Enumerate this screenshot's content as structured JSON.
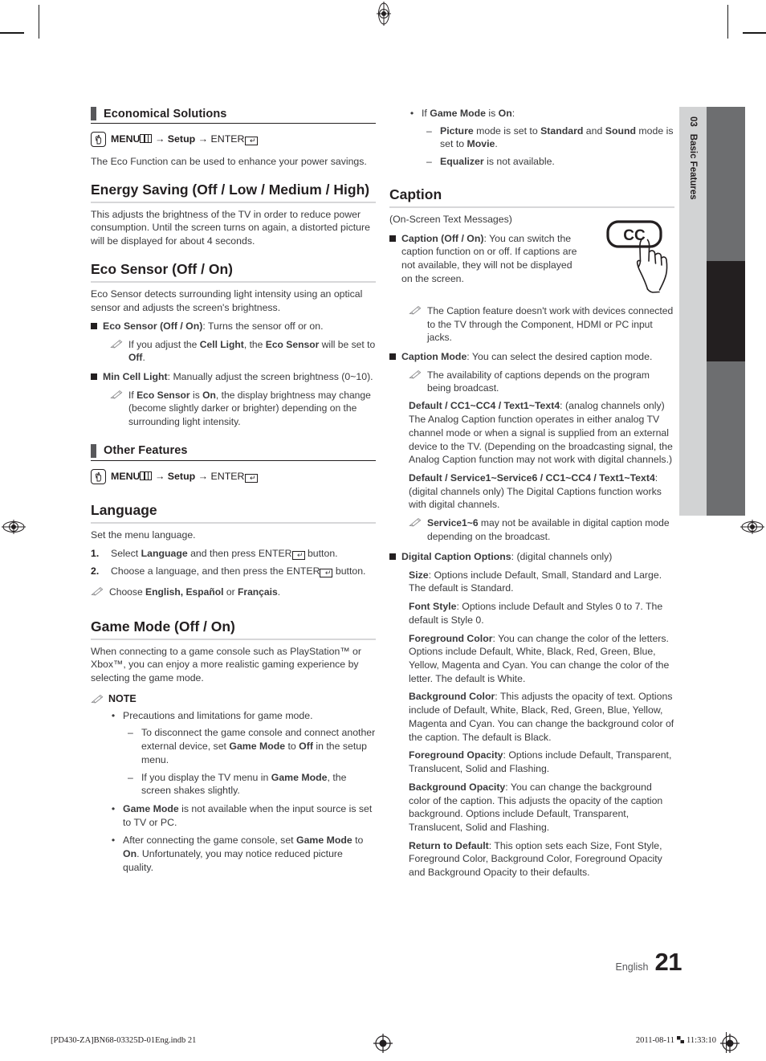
{
  "sidetab": {
    "chapter": "03",
    "title": "Basic Features"
  },
  "page": {
    "language": "English",
    "number": "21"
  },
  "footer": {
    "left": "[PD430-ZA]BN68-03325D-01Eng.indb   21",
    "date": "2011-08-11",
    "time": "11:33:10"
  },
  "left_column": {
    "band1": {
      "label": "Economical Solutions"
    },
    "menu_path1": {
      "menu": "MENU",
      "arrow1": "→",
      "setup": "Setup",
      "arrow2": "→",
      "enter": "ENTER"
    },
    "intro1": "The Eco Function can be used to enhance your power savings.",
    "energy_saving": {
      "heading": "Energy Saving (Off / Low / Medium / High)",
      "body": "This adjusts the brightness of the TV in order to reduce power consumption. Until the screen turns on again, a distorted picture will be displayed for about 4 seconds."
    },
    "eco_sensor": {
      "heading": "Eco Sensor (Off / On)",
      "body": "Eco Sensor detects surrounding light intensity using an optical sensor and adjusts the screen's brightness.",
      "item1_bold": "Eco Sensor (Off / On)",
      "item1_rest": ": Turns the sensor off or on.",
      "note1_a": "If you adjust the ",
      "note1_b": "Cell Light",
      "note1_c": ", the ",
      "note1_d": "Eco Sensor",
      "note1_e": " will be set to ",
      "note1_f": "Off",
      "note1_g": ".",
      "item2_bold": "Min Cell Light",
      "item2_rest": ": Manually adjust the screen brightness (0~10).",
      "note2_a": "If ",
      "note2_b": "Eco Sensor",
      "note2_c": " is ",
      "note2_d": "On",
      "note2_e": ", the display brightness may change (become slightly darker or brighter) depending on the surrounding light intensity."
    },
    "band2": {
      "label": "Other Features"
    },
    "menu_path2": {
      "menu": "MENU",
      "arrow1": "→",
      "setup": "Setup",
      "arrow2": "→",
      "enter": "ENTER"
    },
    "language": {
      "heading": "Language",
      "body": "Set the menu language.",
      "step1_n": "1.",
      "step1_a": "Select ",
      "step1_b": "Language",
      "step1_c": " and then press ENTER",
      "step1_d": " button.",
      "step2_n": "2.",
      "step2_a": "Choose a language, and then press the ENTER",
      "step2_b": " button.",
      "note_a": "Choose ",
      "note_b": "English, Español",
      "note_c": " or ",
      "note_d": "Français",
      "note_e": "."
    },
    "game_mode": {
      "heading": "Game Mode (Off / On)",
      "body": "When connecting to a game console such as PlayStation™ or Xbox™, you can enjoy a more realistic gaming experience by selecting the game mode.",
      "note_label": "NOTE",
      "b1": "Precautions and limitations for game mode.",
      "b1_d1_a": "To disconnect the game console and connect another external device, set ",
      "b1_d1_b": "Game Mode",
      "b1_d1_c": " to ",
      "b1_d1_d": "Off",
      "b1_d1_e": " in the setup menu.",
      "b1_d2_a": "If you display the TV menu in ",
      "b1_d2_b": "Game Mode",
      "b1_d2_c": ", the screen shakes slightly.",
      "b2_a": "Game Mode",
      "b2_b": " is not available when the input source is set to TV or PC.",
      "b3_a": "After connecting the game console, set ",
      "b3_b": "Game Mode",
      "b3_c": " to ",
      "b3_d": "On",
      "b3_e": ". Unfortunately, you may notice reduced picture quality."
    }
  },
  "right_column": {
    "b1_a": "If ",
    "b1_b": "Game Mode",
    "b1_c": " is ",
    "b1_d": "On",
    "b1_e": ":",
    "b1_d1_a": "Picture",
    "b1_d1_b": " mode is set to ",
    "b1_d1_c": "Standard",
    "b1_d1_d": " and ",
    "b1_d1_e": "Sound",
    "b1_d1_f": " mode is set to ",
    "b1_d1_g": "Movie",
    "b1_d1_h": ".",
    "b1_d2_a": "Equalizer",
    "b1_d2_b": " is not available.",
    "caption": {
      "heading": "Caption",
      "subtitle": "(On-Screen Text Messages)",
      "icon_label": "CC",
      "item1_bold": "Caption (Off / On)",
      "item1_rest": ": You can switch the caption function on or off. If captions are not available, they will not be displayed on the screen.",
      "note1": "The Caption feature doesn't work with devices connected to the TV through the Component, HDMI or PC input jacks.",
      "item2_bold": "Caption Mode",
      "item2_rest": ": You can select the desired caption mode.",
      "note2": "The availability of captions depends on the program being broadcast.",
      "analog_bold": "Default / CC1~CC4 / Text1~Text4",
      "analog_rest": ": (analog channels only) The Analog Caption function operates in either analog TV channel mode or when a signal is supplied from an external device to the TV. (Depending on the broadcasting signal, the Analog Caption function may not work with digital channels.)",
      "digital_bold": "Default / Service1~Service6 / CC1~CC4 / Text1~Text4",
      "digital_rest": ": (digital channels only) The Digital Captions function works with digital channels.",
      "note3_a": "Service1~6",
      "note3_b": " may not be available in digital caption mode depending on the broadcast.",
      "dco_bold": "Digital Caption Options",
      "dco_rest": ": (digital channels only)",
      "size_bold": "Size",
      "size_rest": ": Options include Default, Small, Standard and Large. The default is Standard.",
      "fontstyle_bold": "Font Style",
      "fontstyle_rest": ": Options include Default and Styles 0 to 7. The default is Style 0.",
      "fgcolor_bold": "Foreground Color",
      "fgcolor_rest": ": You can change the color of the letters. Options include Default, White, Black, Red, Green, Blue, Yellow, Magenta and Cyan. You can change the color of the letter. The default is White.",
      "bgcolor_bold": "Background Color",
      "bgcolor_rest": ": This adjusts the opacity of text. Options include of Default, White, Black, Red, Green, Blue, Yellow, Magenta and Cyan. You can change the background color of the caption. The default is Black.",
      "fgopacity_bold": "Foreground Opacity",
      "fgopacity_rest": ": Options include Default, Transparent, Translucent, Solid and Flashing.",
      "bgopacity_bold": "Background Opacity",
      "bgopacity_rest": ": You can change the background color of the caption. This adjusts the opacity of the caption background. Options include Default, Transparent, Translucent, Solid and Flashing.",
      "return_bold": "Return to Default",
      "return_rest": ": This option sets each Size, Font Style, Foreground Color, Background Color, Foreground Opacity and Background Opacity to their defaults."
    }
  }
}
